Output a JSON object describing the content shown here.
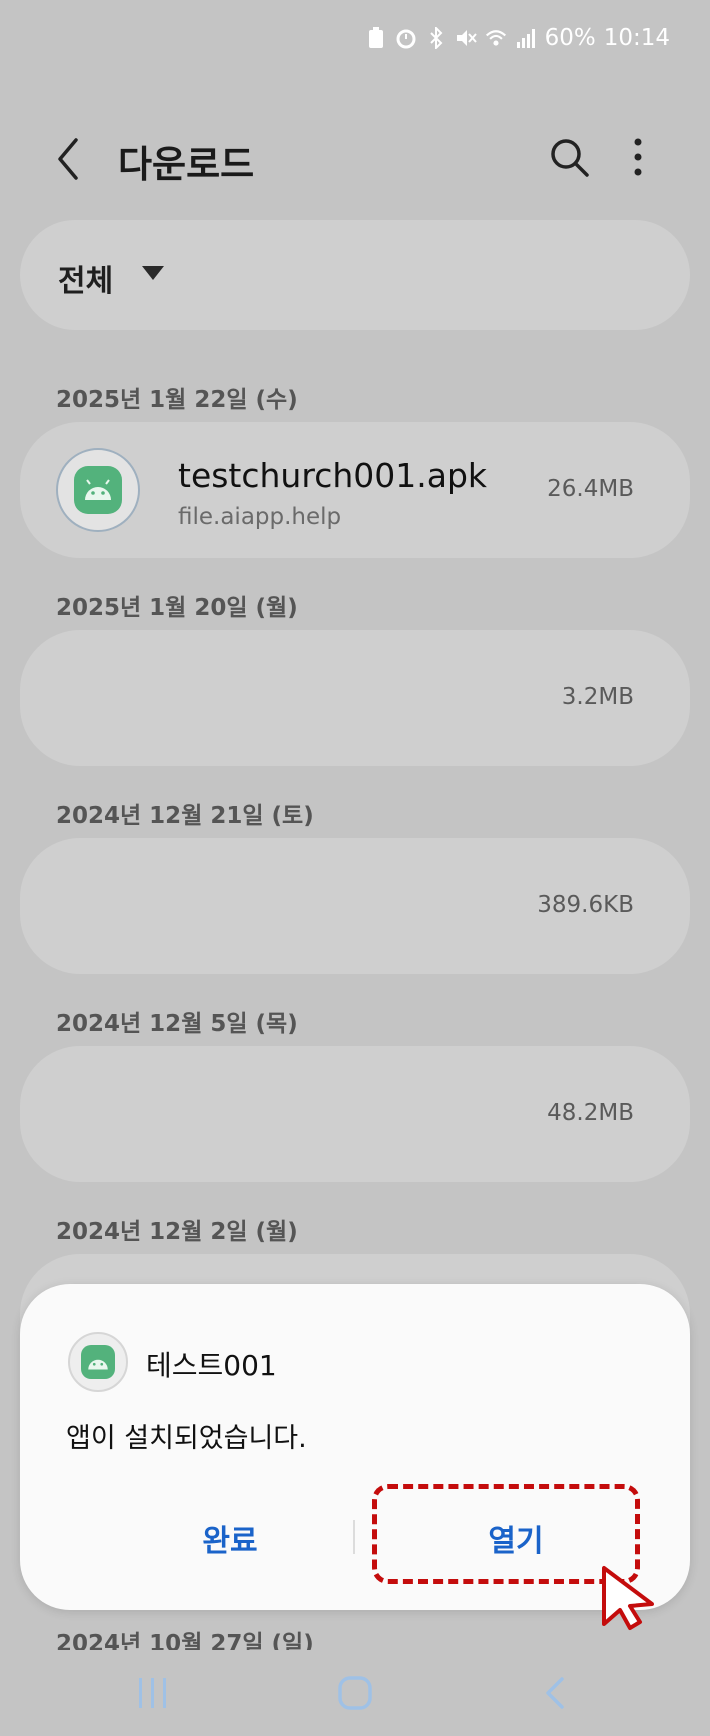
{
  "status": {
    "battery": "60%",
    "time": "10:14",
    "icons": [
      "battery-saver-icon",
      "alarm-icon",
      "bluetooth-icon",
      "mute-icon",
      "wifi-icon",
      "signal-icon"
    ]
  },
  "header": {
    "title": "다운로드"
  },
  "filter": {
    "label": "전체"
  },
  "sections": [
    {
      "date": "2025년 1월 22일 (수)",
      "file_name": "testchurch001.apk",
      "file_host": "file.aiapp.help",
      "size": "26.4MB"
    },
    {
      "date": "2025년 1월 20일 (월)",
      "size": "3.2MB"
    },
    {
      "date": "2024년 12월 21일 (토)",
      "size": "389.6KB"
    },
    {
      "date": "2024년 12월 5일 (목)",
      "size": "48.2MB"
    },
    {
      "date": "2024년 12월 2일 (월)"
    }
  ],
  "partial_date": "2024년 10월 27일 (일)",
  "dialog": {
    "app_name": "테스트001",
    "message": "앱이 설치되었습니다.",
    "done_label": "완료",
    "open_label": "열기"
  },
  "colors": {
    "background": "#c4c4c4",
    "card": "#cfcfcf",
    "dialog": "#fafafa",
    "button_text": "#1a63c9",
    "highlight": "#c40c0c",
    "app_icon": "#53b27c"
  }
}
